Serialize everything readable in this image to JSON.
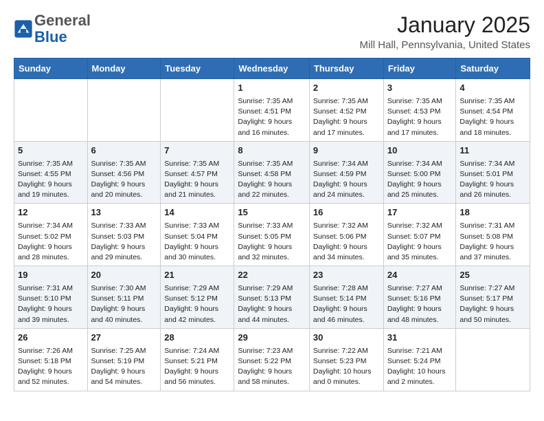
{
  "header": {
    "logo_general": "General",
    "logo_blue": "Blue",
    "month": "January 2025",
    "location": "Mill Hall, Pennsylvania, United States"
  },
  "days_of_week": [
    "Sunday",
    "Monday",
    "Tuesday",
    "Wednesday",
    "Thursday",
    "Friday",
    "Saturday"
  ],
  "weeks": [
    [
      {
        "day": "",
        "info": ""
      },
      {
        "day": "",
        "info": ""
      },
      {
        "day": "",
        "info": ""
      },
      {
        "day": "1",
        "info": "Sunrise: 7:35 AM\nSunset: 4:51 PM\nDaylight: 9 hours\nand 16 minutes."
      },
      {
        "day": "2",
        "info": "Sunrise: 7:35 AM\nSunset: 4:52 PM\nDaylight: 9 hours\nand 17 minutes."
      },
      {
        "day": "3",
        "info": "Sunrise: 7:35 AM\nSunset: 4:53 PM\nDaylight: 9 hours\nand 17 minutes."
      },
      {
        "day": "4",
        "info": "Sunrise: 7:35 AM\nSunset: 4:54 PM\nDaylight: 9 hours\nand 18 minutes."
      }
    ],
    [
      {
        "day": "5",
        "info": "Sunrise: 7:35 AM\nSunset: 4:55 PM\nDaylight: 9 hours\nand 19 minutes."
      },
      {
        "day": "6",
        "info": "Sunrise: 7:35 AM\nSunset: 4:56 PM\nDaylight: 9 hours\nand 20 minutes."
      },
      {
        "day": "7",
        "info": "Sunrise: 7:35 AM\nSunset: 4:57 PM\nDaylight: 9 hours\nand 21 minutes."
      },
      {
        "day": "8",
        "info": "Sunrise: 7:35 AM\nSunset: 4:58 PM\nDaylight: 9 hours\nand 22 minutes."
      },
      {
        "day": "9",
        "info": "Sunrise: 7:34 AM\nSunset: 4:59 PM\nDaylight: 9 hours\nand 24 minutes."
      },
      {
        "day": "10",
        "info": "Sunrise: 7:34 AM\nSunset: 5:00 PM\nDaylight: 9 hours\nand 25 minutes."
      },
      {
        "day": "11",
        "info": "Sunrise: 7:34 AM\nSunset: 5:01 PM\nDaylight: 9 hours\nand 26 minutes."
      }
    ],
    [
      {
        "day": "12",
        "info": "Sunrise: 7:34 AM\nSunset: 5:02 PM\nDaylight: 9 hours\nand 28 minutes."
      },
      {
        "day": "13",
        "info": "Sunrise: 7:33 AM\nSunset: 5:03 PM\nDaylight: 9 hours\nand 29 minutes."
      },
      {
        "day": "14",
        "info": "Sunrise: 7:33 AM\nSunset: 5:04 PM\nDaylight: 9 hours\nand 30 minutes."
      },
      {
        "day": "15",
        "info": "Sunrise: 7:33 AM\nSunset: 5:05 PM\nDaylight: 9 hours\nand 32 minutes."
      },
      {
        "day": "16",
        "info": "Sunrise: 7:32 AM\nSunset: 5:06 PM\nDaylight: 9 hours\nand 34 minutes."
      },
      {
        "day": "17",
        "info": "Sunrise: 7:32 AM\nSunset: 5:07 PM\nDaylight: 9 hours\nand 35 minutes."
      },
      {
        "day": "18",
        "info": "Sunrise: 7:31 AM\nSunset: 5:08 PM\nDaylight: 9 hours\nand 37 minutes."
      }
    ],
    [
      {
        "day": "19",
        "info": "Sunrise: 7:31 AM\nSunset: 5:10 PM\nDaylight: 9 hours\nand 39 minutes."
      },
      {
        "day": "20",
        "info": "Sunrise: 7:30 AM\nSunset: 5:11 PM\nDaylight: 9 hours\nand 40 minutes."
      },
      {
        "day": "21",
        "info": "Sunrise: 7:29 AM\nSunset: 5:12 PM\nDaylight: 9 hours\nand 42 minutes."
      },
      {
        "day": "22",
        "info": "Sunrise: 7:29 AM\nSunset: 5:13 PM\nDaylight: 9 hours\nand 44 minutes."
      },
      {
        "day": "23",
        "info": "Sunrise: 7:28 AM\nSunset: 5:14 PM\nDaylight: 9 hours\nand 46 minutes."
      },
      {
        "day": "24",
        "info": "Sunrise: 7:27 AM\nSunset: 5:16 PM\nDaylight: 9 hours\nand 48 minutes."
      },
      {
        "day": "25",
        "info": "Sunrise: 7:27 AM\nSunset: 5:17 PM\nDaylight: 9 hours\nand 50 minutes."
      }
    ],
    [
      {
        "day": "26",
        "info": "Sunrise: 7:26 AM\nSunset: 5:18 PM\nDaylight: 9 hours\nand 52 minutes."
      },
      {
        "day": "27",
        "info": "Sunrise: 7:25 AM\nSunset: 5:19 PM\nDaylight: 9 hours\nand 54 minutes."
      },
      {
        "day": "28",
        "info": "Sunrise: 7:24 AM\nSunset: 5:21 PM\nDaylight: 9 hours\nand 56 minutes."
      },
      {
        "day": "29",
        "info": "Sunrise: 7:23 AM\nSunset: 5:22 PM\nDaylight: 9 hours\nand 58 minutes."
      },
      {
        "day": "30",
        "info": "Sunrise: 7:22 AM\nSunset: 5:23 PM\nDaylight: 10 hours\nand 0 minutes."
      },
      {
        "day": "31",
        "info": "Sunrise: 7:21 AM\nSunset: 5:24 PM\nDaylight: 10 hours\nand 2 minutes."
      },
      {
        "day": "",
        "info": ""
      }
    ]
  ]
}
